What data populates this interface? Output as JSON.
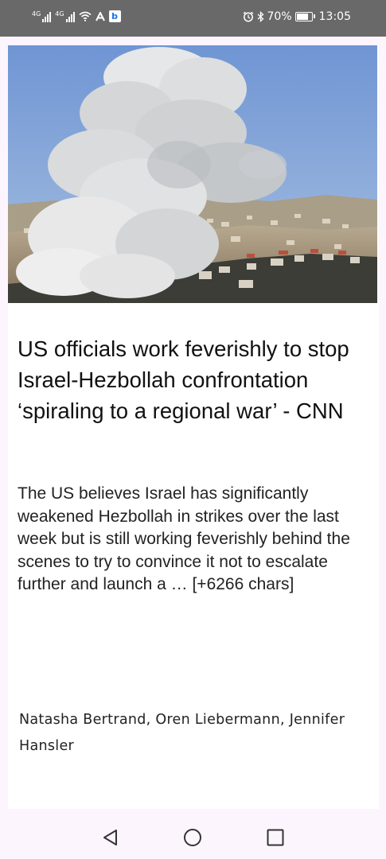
{
  "status_bar": {
    "network_1": "4G",
    "network_2": "4G",
    "bing_badge": "b",
    "battery": "70%",
    "battery_level": 0.7,
    "time": "13:05",
    "icons": [
      "signal-icon",
      "wifi-icon",
      "a-notification-icon",
      "bing-icon",
      "alarm-icon",
      "bluetooth-icon",
      "battery-icon"
    ]
  },
  "article": {
    "title": "US officials work feverishly to stop Israel-Hezbollah confrontation ‘spiraling to a regional war’ - CNN",
    "description": "The US believes Israel has significantly weakened Hezbollah in strikes over the last week but is still working feverishly behind the scenes to try to convince it not to escalate further and launch a … [+6266 chars]",
    "authors": "Natasha Bertrand, Oren Liebermann, Jennifer Hansler"
  },
  "nav_bar": {
    "icons": [
      "back-icon",
      "home-icon",
      "recents-icon"
    ]
  }
}
